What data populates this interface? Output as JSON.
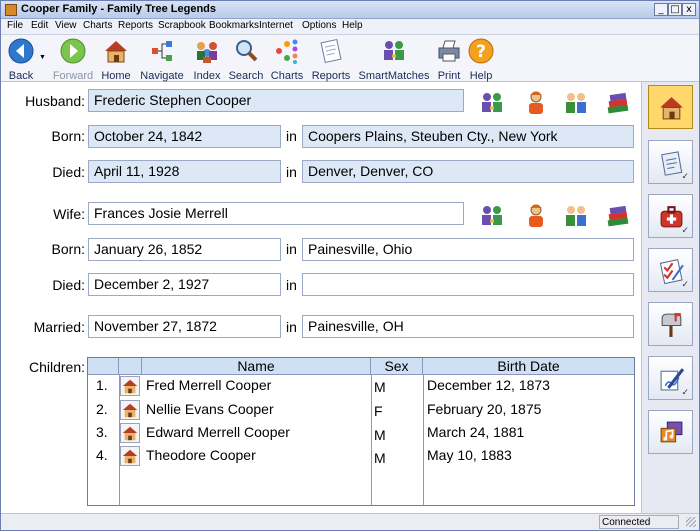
{
  "window": {
    "title": "Cooper Family - Family Tree Legends",
    "min": "_",
    "max": "□",
    "close": "x"
  },
  "menu": [
    "File",
    "Edit",
    "View",
    "Charts",
    "Reports",
    "Scrapbook",
    "Bookmarks",
    "Internet",
    "Options",
    "Help"
  ],
  "toolbar": {
    "back": "Back",
    "forward": "Forward",
    "home": "Home",
    "navigate": "Navigate",
    "index": "Index",
    "search": "Search",
    "charts": "Charts",
    "reports": "Reports",
    "smartmatches": "SmartMatches",
    "print": "Print",
    "help": "Help"
  },
  "labels": {
    "husband": "Husband:",
    "born": "Born:",
    "died": "Died:",
    "wife": "Wife:",
    "married": "Married:",
    "children": "Children:",
    "in": "in"
  },
  "husband": {
    "name": "Frederic Stephen Cooper",
    "born_date": "October 24, 1842",
    "born_place": "Coopers Plains, Steuben Cty., New York",
    "died_date": "April 11, 1928",
    "died_place": "Denver, Denver, CO"
  },
  "wife": {
    "name": "Frances Josie Merrell",
    "born_date": "January 26, 1852",
    "born_place": "Painesville, Ohio",
    "died_date": "December 2, 1927",
    "died_place": ""
  },
  "marriage": {
    "date": "November 27, 1872",
    "place": "Painesville, OH"
  },
  "children_table": {
    "headers": {
      "name": "Name",
      "sex": "Sex",
      "birth": "Birth Date"
    },
    "rows": [
      {
        "num": "1.",
        "name": "Fred Merrell Cooper",
        "sex": "M",
        "birth": "December 12, 1873"
      },
      {
        "num": "2.",
        "name": "Nellie Evans Cooper",
        "sex": "F",
        "birth": "February 20, 1875"
      },
      {
        "num": "3.",
        "name": "Edward Merrell Cooper",
        "sex": "M",
        "birth": "March 24, 1881"
      },
      {
        "num": "4.",
        "name": "Theodore Cooper",
        "sex": "M",
        "birth": "May 10, 1883"
      }
    ]
  },
  "statusbar": {
    "status": "Connected"
  },
  "colors": {
    "toolbar_bg": "#f3f5fa",
    "field_blue": "#dde8f7",
    "header_blue": "#cfe0f4",
    "side_active": "#ffd76a"
  }
}
